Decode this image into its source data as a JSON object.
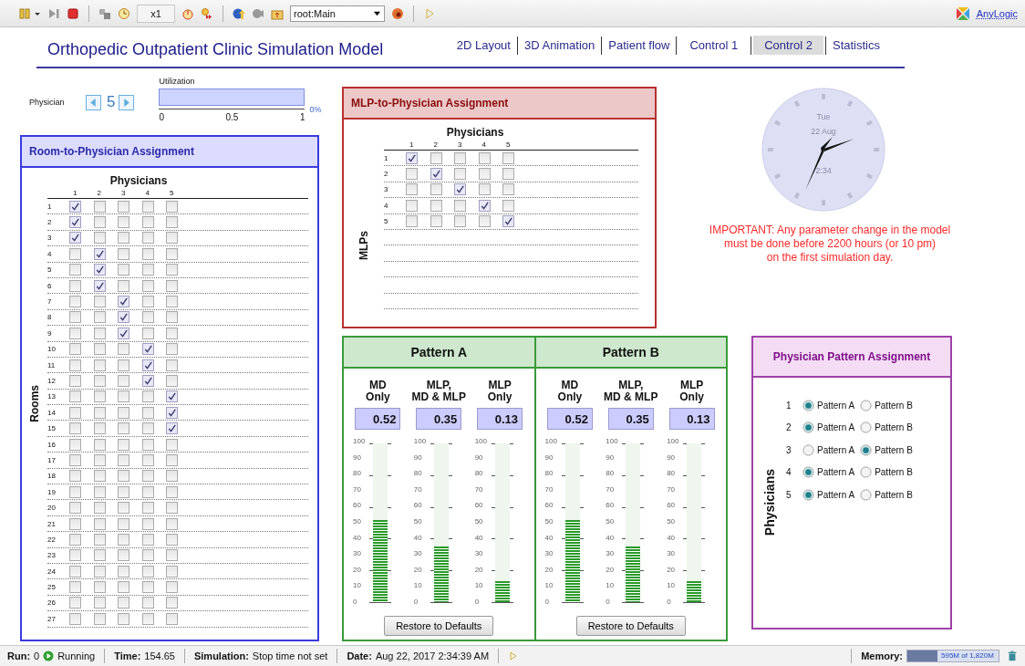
{
  "toolbar": {
    "speed": "x1",
    "view": "root:Main",
    "brand": "AnyLogic"
  },
  "title": "Orthopedic Outpatient Clinic Simulation Model",
  "tabs": [
    {
      "label": "2D Layout",
      "selected": false
    },
    {
      "label": "3D Animation",
      "selected": false
    },
    {
      "label": "Patient flow",
      "selected": false
    },
    {
      "label": "Control 1",
      "selected": false
    },
    {
      "label": "Control 2",
      "selected": true
    },
    {
      "label": "Statistics",
      "selected": false
    }
  ],
  "physician_selector": {
    "label": "Physician",
    "value": "5"
  },
  "utilization": {
    "label": "Utilization",
    "level": 0,
    "reading": "0%",
    "ticks": [
      "0",
      "0.5",
      "1"
    ]
  },
  "room_assignment": {
    "title": "Room-to-Physician Assignment",
    "column_heading": "Physicians",
    "row_heading": "Rooms",
    "columns": [
      "1",
      "2",
      "3",
      "4",
      "5"
    ],
    "rows": [
      {
        "label": "1",
        "checks": [
          true,
          false,
          false,
          false,
          false
        ]
      },
      {
        "label": "2",
        "checks": [
          true,
          false,
          false,
          false,
          false
        ]
      },
      {
        "label": "3",
        "checks": [
          true,
          false,
          false,
          false,
          false
        ]
      },
      {
        "label": "4",
        "checks": [
          false,
          true,
          false,
          false,
          false
        ]
      },
      {
        "label": "5",
        "checks": [
          false,
          true,
          false,
          false,
          false
        ]
      },
      {
        "label": "6",
        "checks": [
          false,
          true,
          false,
          false,
          false
        ]
      },
      {
        "label": "7",
        "checks": [
          false,
          false,
          true,
          false,
          false
        ]
      },
      {
        "label": "8",
        "checks": [
          false,
          false,
          true,
          false,
          false
        ]
      },
      {
        "label": "9",
        "checks": [
          false,
          false,
          true,
          false,
          false
        ]
      },
      {
        "label": "10",
        "checks": [
          false,
          false,
          false,
          true,
          false
        ]
      },
      {
        "label": "11",
        "checks": [
          false,
          false,
          false,
          true,
          false
        ]
      },
      {
        "label": "12",
        "checks": [
          false,
          false,
          false,
          true,
          false
        ]
      },
      {
        "label": "13",
        "checks": [
          false,
          false,
          false,
          false,
          true
        ]
      },
      {
        "label": "14",
        "checks": [
          false,
          false,
          false,
          false,
          true
        ]
      },
      {
        "label": "15",
        "checks": [
          false,
          false,
          false,
          false,
          true
        ]
      },
      {
        "label": "16",
        "checks": [
          false,
          false,
          false,
          false,
          false
        ]
      },
      {
        "label": "17",
        "checks": [
          false,
          false,
          false,
          false,
          false
        ]
      },
      {
        "label": "18",
        "checks": [
          false,
          false,
          false,
          false,
          false
        ]
      },
      {
        "label": "19",
        "checks": [
          false,
          false,
          false,
          false,
          false
        ]
      },
      {
        "label": "20",
        "checks": [
          false,
          false,
          false,
          false,
          false
        ]
      },
      {
        "label": "21",
        "checks": [
          false,
          false,
          false,
          false,
          false
        ]
      },
      {
        "label": "22",
        "checks": [
          false,
          false,
          false,
          false,
          false
        ]
      },
      {
        "label": "23",
        "checks": [
          false,
          false,
          false,
          false,
          false
        ]
      },
      {
        "label": "24",
        "checks": [
          false,
          false,
          false,
          false,
          false
        ]
      },
      {
        "label": "25",
        "checks": [
          false,
          false,
          false,
          false,
          false
        ]
      },
      {
        "label": "26",
        "checks": [
          false,
          false,
          false,
          false,
          false
        ]
      },
      {
        "label": "27",
        "checks": [
          false,
          false,
          false,
          false,
          false
        ]
      }
    ]
  },
  "mlp_assignment": {
    "title": "MLP-to-Physician Assignment",
    "column_heading": "Physicians",
    "row_heading": "MLPs",
    "columns": [
      "1",
      "2",
      "3",
      "4",
      "5"
    ],
    "rows": [
      {
        "label": "1",
        "checks": [
          true,
          false,
          false,
          false,
          false
        ]
      },
      {
        "label": "2",
        "checks": [
          false,
          true,
          false,
          false,
          false
        ]
      },
      {
        "label": "3",
        "checks": [
          false,
          false,
          true,
          false,
          false
        ]
      },
      {
        "label": "4",
        "checks": [
          false,
          false,
          false,
          true,
          false
        ]
      },
      {
        "label": "5",
        "checks": [
          false,
          false,
          false,
          false,
          true
        ]
      }
    ]
  },
  "clock": {
    "day": "Tue",
    "date": "22 Aug",
    "time": "2:34"
  },
  "notice": [
    "IMPORTANT: Any parameter change in the model",
    "must be done before 2200 hours (or 10 pm)",
    "on the first simulation day."
  ],
  "patterns": [
    {
      "title": "Pattern A",
      "button": "Restore to Defaults",
      "meters": [
        {
          "label": [
            "MD",
            "Only"
          ],
          "value": "0.52",
          "level": 0.52,
          "scale": [
            "100",
            "90",
            "80",
            "70",
            "60",
            "50",
            "40",
            "30",
            "20",
            "10",
            "0"
          ]
        },
        {
          "label": [
            "MLP,",
            "MD & MLP"
          ],
          "value": "0.35",
          "level": 0.35,
          "scale": [
            "100",
            "90",
            "80",
            "70",
            "60",
            "50",
            "40",
            "30",
            "20",
            "10",
            "0"
          ]
        },
        {
          "label": [
            "MLP",
            "Only"
          ],
          "value": "0.13",
          "level": 0.13,
          "scale": [
            "100",
            "90",
            "80",
            "70",
            "60",
            "50",
            "40",
            "30",
            "20",
            "10",
            "0"
          ]
        }
      ]
    },
    {
      "title": "Pattern B",
      "button": "Restore to Defaults",
      "meters": [
        {
          "label": [
            "MD",
            "Only"
          ],
          "value": "0.52",
          "level": 0.52,
          "scale": [
            "100",
            "90",
            "80",
            "70",
            "60",
            "50",
            "40",
            "30",
            "20",
            "10",
            "0"
          ]
        },
        {
          "label": [
            "MLP,",
            "MD & MLP"
          ],
          "value": "0.35",
          "level": 0.35,
          "scale": [
            "100",
            "90",
            "80",
            "70",
            "60",
            "50",
            "40",
            "30",
            "20",
            "10",
            "0"
          ]
        },
        {
          "label": [
            "MLP",
            "Only"
          ],
          "value": "0.13",
          "level": 0.13,
          "scale": [
            "100",
            "90",
            "80",
            "70",
            "60",
            "50",
            "40",
            "30",
            "20",
            "10",
            "0"
          ]
        }
      ]
    }
  ],
  "pattern_assignment": {
    "title": "Physician Pattern Assignment",
    "row_heading": "Physicians",
    "rows": [
      {
        "label": "1",
        "options": [
          {
            "label": "Pattern A",
            "selected": true
          },
          {
            "label": "Pattern B",
            "selected": false
          }
        ]
      },
      {
        "label": "2",
        "options": [
          {
            "label": "Pattern A",
            "selected": true
          },
          {
            "label": "Pattern B",
            "selected": false
          }
        ]
      },
      {
        "label": "3",
        "options": [
          {
            "label": "Pattern A",
            "selected": false
          },
          {
            "label": "Pattern B",
            "selected": true
          }
        ]
      },
      {
        "label": "4",
        "options": [
          {
            "label": "Pattern A",
            "selected": true
          },
          {
            "label": "Pattern B",
            "selected": false
          }
        ]
      },
      {
        "label": "5",
        "options": [
          {
            "label": "Pattern A",
            "selected": true
          },
          {
            "label": "Pattern B",
            "selected": false
          }
        ]
      }
    ]
  },
  "status_bar": {
    "run_label": "Run:",
    "run_count": "0",
    "state": "Running",
    "time_label": "Time:",
    "time": "154.65",
    "simulation_label": "Simulation:",
    "simulation": "Stop time not set",
    "date_label": "Date:",
    "date": "Aug 22, 2017 2:34:39 AM",
    "memory": {
      "label": "Memory:",
      "reading": "595M of 1,820M",
      "level": 0.33
    }
  }
}
